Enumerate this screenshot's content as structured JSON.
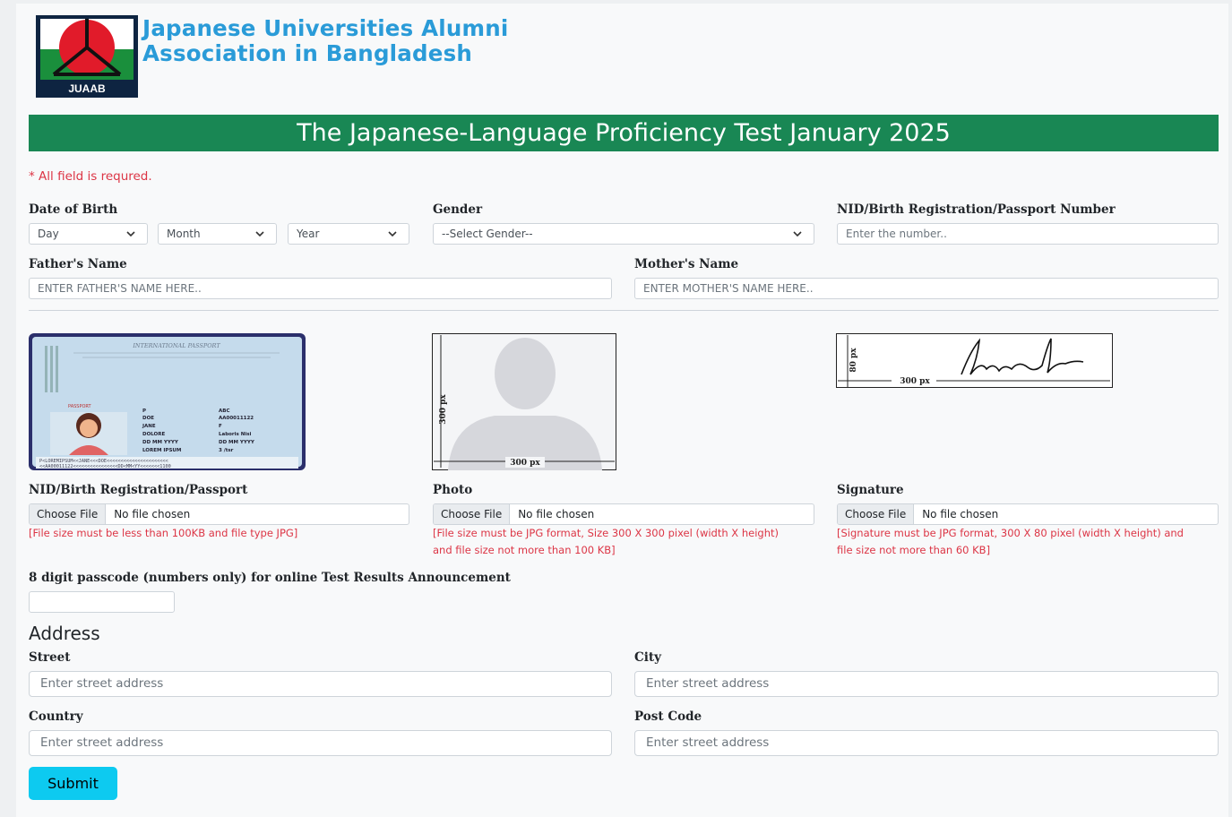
{
  "header": {
    "logo_text": "JUAAB",
    "brand_line1": "Japanese Universities Alumni",
    "brand_line2": "Association in Bangladesh",
    "banner_title": "The Japanese-Language Proficiency Test January 2025"
  },
  "form": {
    "required_note": "* All field is requred.",
    "dob": {
      "label": "Date of Birth",
      "day": "Day",
      "month": "Month",
      "year": "Year"
    },
    "gender": {
      "label": "Gender",
      "value": "--Select Gender--"
    },
    "nid_number": {
      "label": "NID/Birth Registration/Passport Number",
      "placeholder": "Enter the number.."
    },
    "father": {
      "label": "Father's Name",
      "placeholder": "ENTER FATHER'S NAME HERE.."
    },
    "mother": {
      "label": "Mother's Name",
      "placeholder": "ENTER MOTHER'S NAME HERE.."
    },
    "uploads": {
      "nid": {
        "label": "NID/Birth Registration/Passport",
        "button": "Choose File",
        "status": "No file chosen",
        "note": "[File size must be less than 100KB and file type JPG]",
        "sample": {
          "title": "INTERNATIONAL PASSPORT",
          "tag": "PASSPORT",
          "left_col": [
            "P",
            "DOE",
            "JANE",
            "DOLORE",
            "DD MM YYYY",
            "LOREM IPSUM"
          ],
          "right_col": [
            "ABC",
            "AA00011122",
            "F",
            "Laboris Nisi",
            "DD MM YYYY",
            "3 /tsr"
          ],
          "mrz1": "P<LOREMIPSUM<<JANE<<<DOE<<<<<<<<<<<<<<<<<<<<<<",
          "mrz2": "<<AA00011122<<<<<<<<<<<<<<<<DD<MM<YY<<<<<<<1100"
        }
      },
      "photo": {
        "label": "Photo",
        "button": "Choose File",
        "status": "No file chosen",
        "note_line1": "[File size must be JPG format, Size 300 X 300 pixel (width X height)",
        "note_line2": "and file size not more than 100 KB]",
        "dim_h": "300 px",
        "dim_w": "300 px"
      },
      "signature": {
        "label": "Signature",
        "button": "Choose File",
        "status": "No file chosen",
        "note_line1": "[Signature must be JPG format, 300 X 80 pixel (width X height) and",
        "note_line2": "file size not more than 60 KB]",
        "dim_h": "80 px",
        "dim_w": "300 px"
      }
    },
    "passcode": {
      "label": "8 digit passcode (numbers only) for online Test Results Announcement"
    },
    "address": {
      "title": "Address",
      "street": {
        "label": "Street",
        "placeholder": "Enter street address"
      },
      "city": {
        "label": "City",
        "placeholder": "Enter street address"
      },
      "country": {
        "label": "Country",
        "placeholder": "Enter street address"
      },
      "post_code": {
        "label": "Post Code",
        "placeholder": "Enter street address"
      }
    },
    "submit": "Submit"
  },
  "colors": {
    "banner": "#198754",
    "brand": "#2a9bd8",
    "error": "#dc3545",
    "submit": "#0dcaf0"
  }
}
